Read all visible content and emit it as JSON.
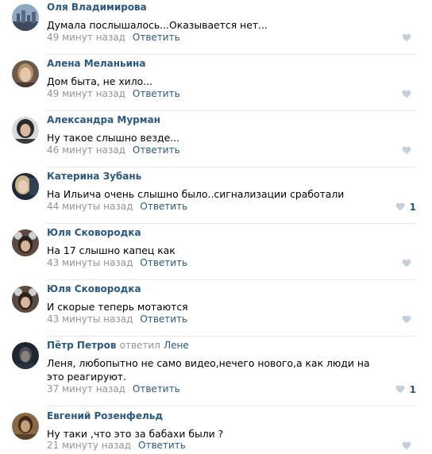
{
  "reply_label": "Ответить",
  "comments": [
    {
      "author": "Оля Владимирова",
      "text": "Думала послышалось...Оказывается нет...",
      "time": "49 минут назад",
      "likes": "",
      "avatar": "cityscape"
    },
    {
      "author": "Алена Меланьина",
      "text": "Дом быта, не хило...",
      "time": "49 минут назад",
      "likes": "",
      "avatar": "woman-blonde"
    },
    {
      "author": "Александра Мурман",
      "text": "Ну такое слышно везде...",
      "time": "46 минут назад",
      "likes": "",
      "avatar": "woman-dark-hair"
    },
    {
      "author": "Катерина Зубань",
      "text": "На Ильича очень слышно было..сигнализации сработали",
      "time": "44 минуты назад",
      "likes": "1",
      "avatar": "woman-light-hair"
    },
    {
      "author": "Юля Сковородка",
      "text": "На 17 слышно капец как",
      "time": "43 минуты назад",
      "likes": "",
      "avatar": "girl-ears"
    },
    {
      "author": "Юля Сковородка",
      "text": "И скорые теперь мотаются",
      "time": "43 минуты назад",
      "likes": "",
      "avatar": "girl-ears"
    },
    {
      "author": "Пётр Петров",
      "reply_word": "ответил",
      "reply_to": "Лене",
      "text": "Леня, любопытно не само видео,нечего нового,а как люди на это реагируют.",
      "time": "37 минут назад",
      "likes": "1",
      "avatar": "man-dark"
    },
    {
      "author": "Евгений Розенфельд",
      "text": "Ну таки ,что это за бабахи были ?",
      "time": "21 минуту назад",
      "likes": "",
      "avatar": "man-sepia"
    }
  ],
  "colors": {
    "link": "#2a5885",
    "meta": "#939393",
    "divider": "#e7e8ec",
    "heart": "#c5d0db"
  },
  "icons": {
    "like": "heart-icon"
  }
}
